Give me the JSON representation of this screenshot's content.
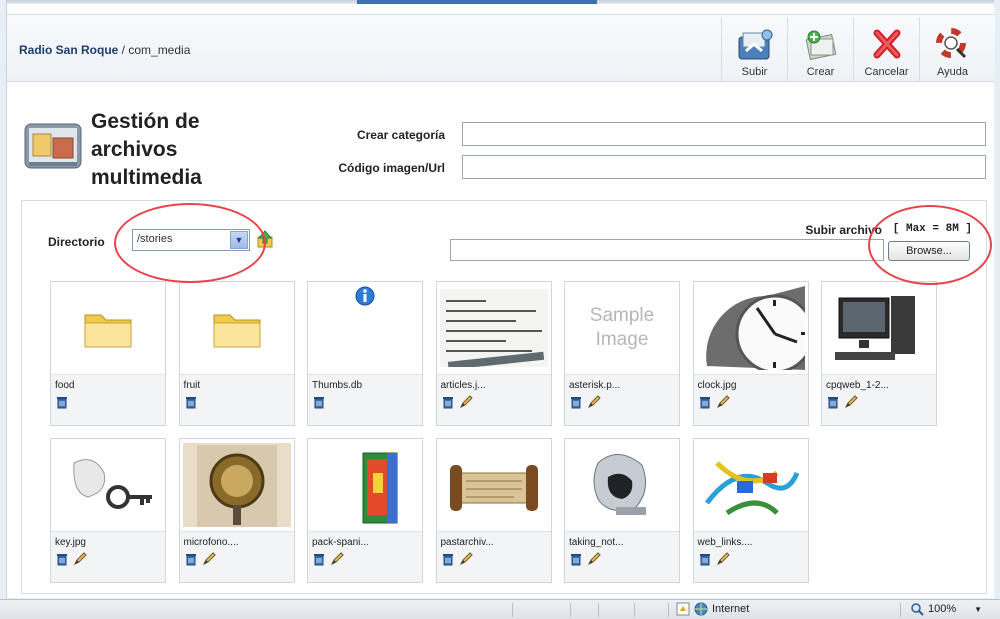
{
  "header": {
    "site": "Radio San Roque",
    "path": " / com_media"
  },
  "toolbar": {
    "upload": "Subir",
    "create": "Crear",
    "cancel": "Cancelar",
    "help": "Ayuda"
  },
  "title": "Gestión de archivos multimedia",
  "form": {
    "create_category_label": "Crear categoría",
    "create_category_value": "",
    "image_code_label": "Código imagen/Url",
    "image_code_value": ""
  },
  "browser": {
    "directory_label": "Directorio",
    "directory_value": "/stories",
    "upload_label": "Subir archivo",
    "max_label": "[ Max = 8M ]",
    "browse_button": "Browse..."
  },
  "files": [
    {
      "name": "food",
      "kind": "folder"
    },
    {
      "name": "fruit",
      "kind": "folder"
    },
    {
      "name": "Thumbs.db",
      "kind": "info"
    },
    {
      "name": "articles.j...",
      "kind": "image-articles"
    },
    {
      "name": "asterisk.p...",
      "kind": "sample"
    },
    {
      "name": "clock.jpg",
      "kind": "image-clock"
    },
    {
      "name": "cpqweb_1-2...",
      "kind": "image-computer"
    },
    {
      "name": "key.jpg",
      "kind": "image-key"
    },
    {
      "name": "microfono....",
      "kind": "image-mic"
    },
    {
      "name": "pack-spani...",
      "kind": "image-pack"
    },
    {
      "name": "pastarchiv...",
      "kind": "image-scroll"
    },
    {
      "name": "taking_not...",
      "kind": "image-notes"
    },
    {
      "name": "web_links....",
      "kind": "image-cables"
    }
  ],
  "sample_image_text": [
    "Sample",
    "Image"
  ],
  "statusbar": {
    "zone": "Internet",
    "zoom": "100%"
  },
  "colors": {
    "annotation": "#e8424a",
    "title": "#222222",
    "crumb_site": "#1c3c6e"
  }
}
